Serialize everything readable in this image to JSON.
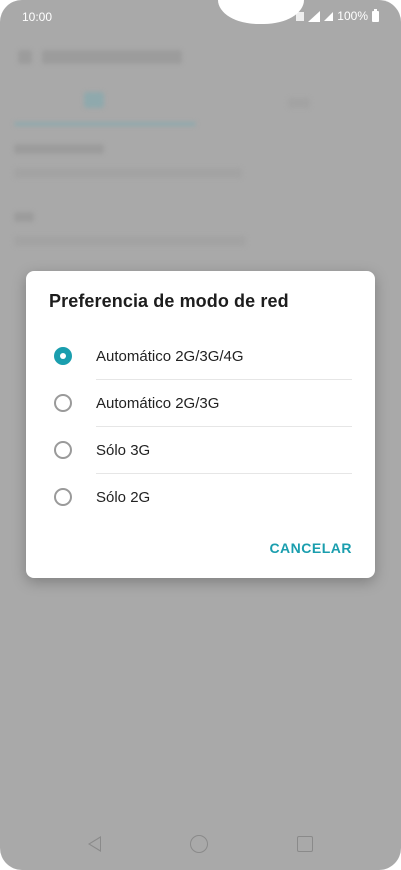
{
  "status": {
    "time": "10:00",
    "battery": "100%"
  },
  "dialog": {
    "title": "Preferencia de modo de red",
    "options": [
      {
        "label": "Automático 2G/3G/4G",
        "selected": true
      },
      {
        "label": "Automático 2G/3G",
        "selected": false
      },
      {
        "label": "Sólo 3G",
        "selected": false
      },
      {
        "label": "Sólo 2G",
        "selected": false
      }
    ],
    "cancel_label": "CANCELAR"
  },
  "colors": {
    "accent": "#1a9eae",
    "scrim": "#a9a9a9"
  },
  "icons": {
    "back": "back-triangle-icon",
    "home": "home-circle-icon",
    "recent": "recent-square-icon"
  }
}
